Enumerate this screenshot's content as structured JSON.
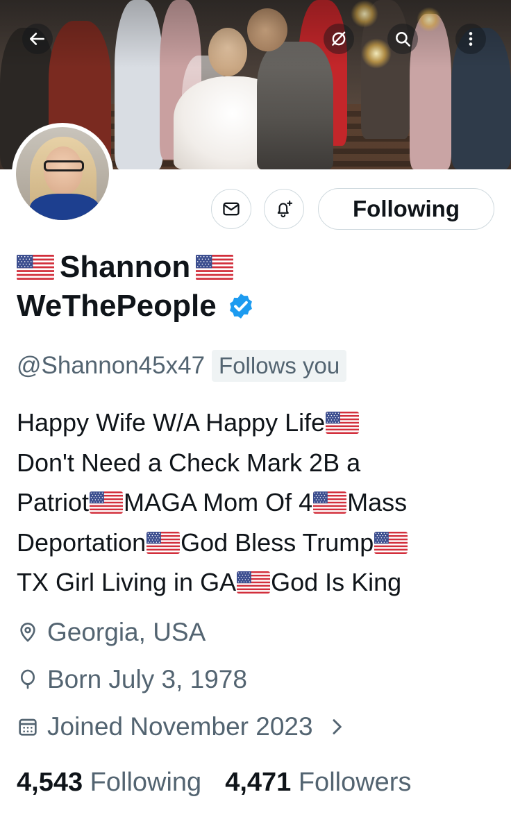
{
  "header": {
    "back_icon": "arrow-left-icon",
    "grok_icon": "grok-icon",
    "search_icon": "search-icon",
    "more_icon": "more-vertical-icon"
  },
  "actions": {
    "message_icon": "envelope-icon",
    "notify_icon": "bell-plus-icon",
    "follow_label": "Following"
  },
  "profile": {
    "name_line1": "Shannon",
    "name_line2": "WeThePeople",
    "handle": "@Shannon45x47",
    "follows_you": "Follows you",
    "bio": {
      "l1a": "Happy Wife W/A Happy Life",
      "l2": "Don't Need a Check Mark 2B a",
      "l3a": "Patriot",
      "l3b": "MAGA Mom Of 4",
      "l3c": "Mass",
      "l4a": "Deportation",
      "l4b": "God Bless Trump",
      "l5a": "TX Girl Living in GA",
      "l5b": "God Is King"
    },
    "location": "Georgia, USA",
    "birthday": "Born July 3, 1978",
    "joined": "Joined November 2023",
    "following_count": "4,543",
    "following_label": "Following",
    "followers_count": "4,471",
    "followers_label": "Followers"
  },
  "colors": {
    "text": "#0f1419",
    "secondary": "#536471",
    "verified": "#1d9bf0",
    "border": "#cfd9de"
  }
}
